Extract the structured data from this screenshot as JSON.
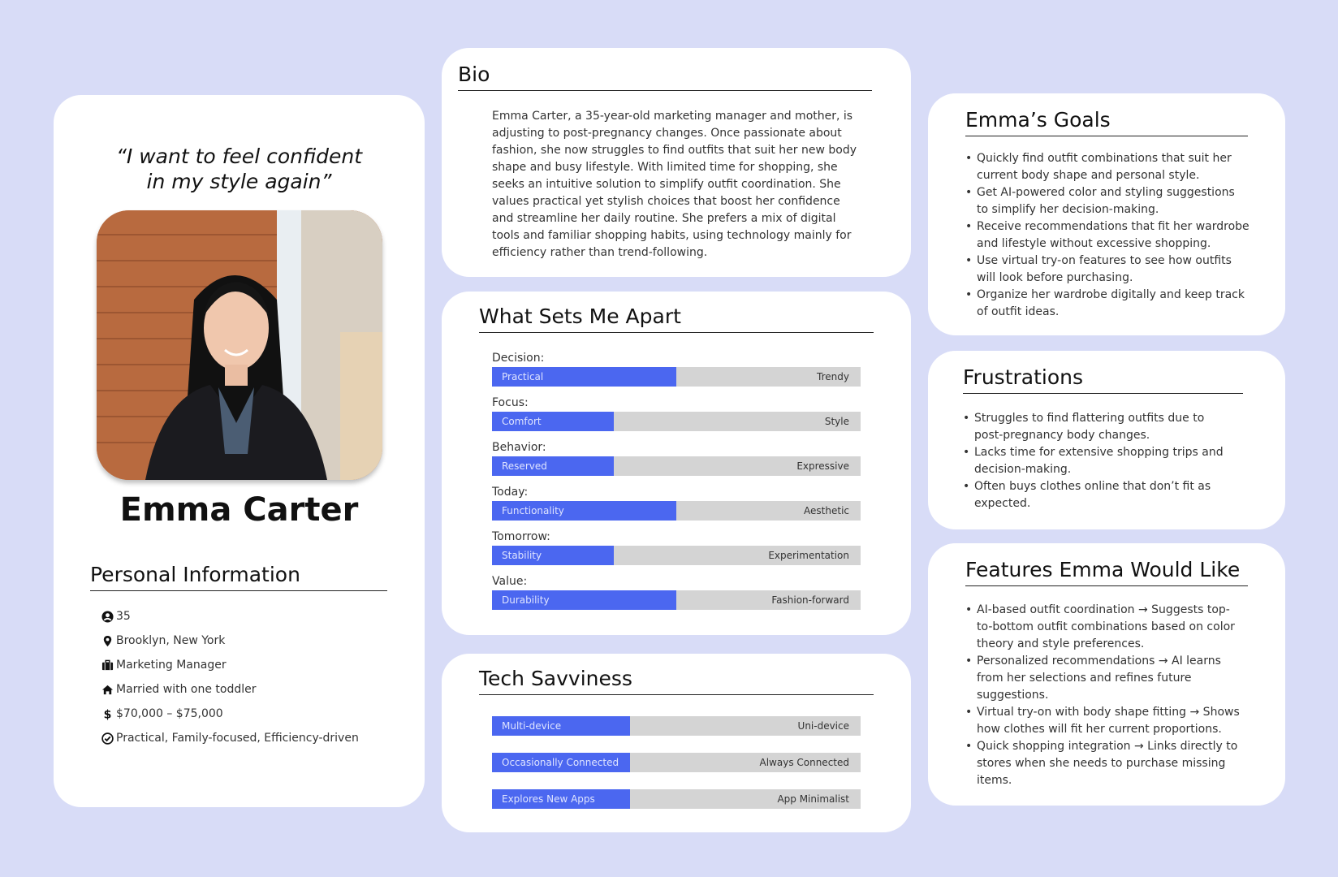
{
  "profile": {
    "quote_line1": "“I want to feel confident",
    "quote_line2": "in my style again”",
    "name": "Emma Carter",
    "personal_info_title": "Personal Information",
    "info": [
      {
        "icon": "user-circle-icon",
        "text": "35"
      },
      {
        "icon": "map-pin-icon",
        "text": "Brooklyn, New York"
      },
      {
        "icon": "briefcase-icon",
        "text": "Marketing Manager"
      },
      {
        "icon": "home-icon",
        "text": "Married with one toddler"
      },
      {
        "icon": "dollar-icon",
        "text": "$70,000 – $75,000"
      },
      {
        "icon": "check-circle-icon",
        "text": "Practical, Family-focused, Efficiency-driven"
      }
    ]
  },
  "bio": {
    "title": "Bio",
    "text": "Emma Carter, a 35-year-old marketing manager and mother, is adjusting to post-pregnancy changes. Once passionate about fashion, she now struggles to find outfits that suit her new body shape and busy lifestyle. With limited time for shopping, she seeks an intuitive solution to simplify outfit coordination. She values practical yet stylish choices that boost her confidence and streamline her daily routine. She prefers a mix of digital tools and familiar shopping habits, using technology mainly for efficiency rather than trend-following."
  },
  "sets_apart": {
    "title": "What Sets Me Apart",
    "rows": [
      {
        "label": "Decision:",
        "left": "Practical",
        "right": "Trendy",
        "level": 0.5
      },
      {
        "label": "Focus:",
        "left": "Comfort",
        "right": "Style",
        "level": 0.33
      },
      {
        "label": "Behavior:",
        "left": "Reserved",
        "right": "Expressive",
        "level": 0.33
      },
      {
        "label": "Today:",
        "left": "Functionality",
        "right": "Aesthetic",
        "level": 0.5
      },
      {
        "label": "Tomorrow:",
        "left": "Stability",
        "right": "Experimentation",
        "level": 0.33
      },
      {
        "label": "Value:",
        "left": "Durability",
        "right": "Fashion-forward",
        "level": 0.5
      }
    ]
  },
  "tech": {
    "title": "Tech Savviness",
    "rows": [
      {
        "left": "Multi-device",
        "right": "Uni-device",
        "level": 0.375
      },
      {
        "left": "Occasionally Connected",
        "right": "Always Connected",
        "level": 0.375
      },
      {
        "left": "Explores New Apps",
        "right": "App Minimalist",
        "level": 0.375
      }
    ]
  },
  "goals": {
    "title": "Emma’s Goals",
    "items": [
      "Quickly find outfit combinations that suit her current body shape and personal style.",
      "Get AI-powered color and styling suggestions to simplify her decision-making.",
      "Receive recommendations that fit her wardrobe and lifestyle without excessive shopping.",
      "Use virtual try-on features to see how outfits will look before purchasing.",
      "Organize her wardrobe digitally and keep track of outfit ideas."
    ]
  },
  "frustrations": {
    "title": "Frustrations",
    "items": [
      "Struggles to find flattering outfits due to post-pregnancy body changes.",
      "Lacks time for extensive shopping trips and decision-making.",
      "Often buys clothes online that don’t fit as expected."
    ]
  },
  "features": {
    "title": "Features Emma Would Like",
    "items": [
      "AI-based outfit coordination → Suggests top-to-bottom outfit combinations based on color theory and style preferences.",
      "Personalized recommendations → AI learns from her selections and refines future suggestions.",
      "Virtual try-on with body shape fitting → Shows how clothes will fit her current proportions.",
      "Quick shopping integration → Links directly to stores when she needs to purchase missing items."
    ]
  },
  "colors": {
    "background": "#d8dcf7",
    "bar_fill": "#4b67f0",
    "bar_track": "#d4d4d4"
  }
}
